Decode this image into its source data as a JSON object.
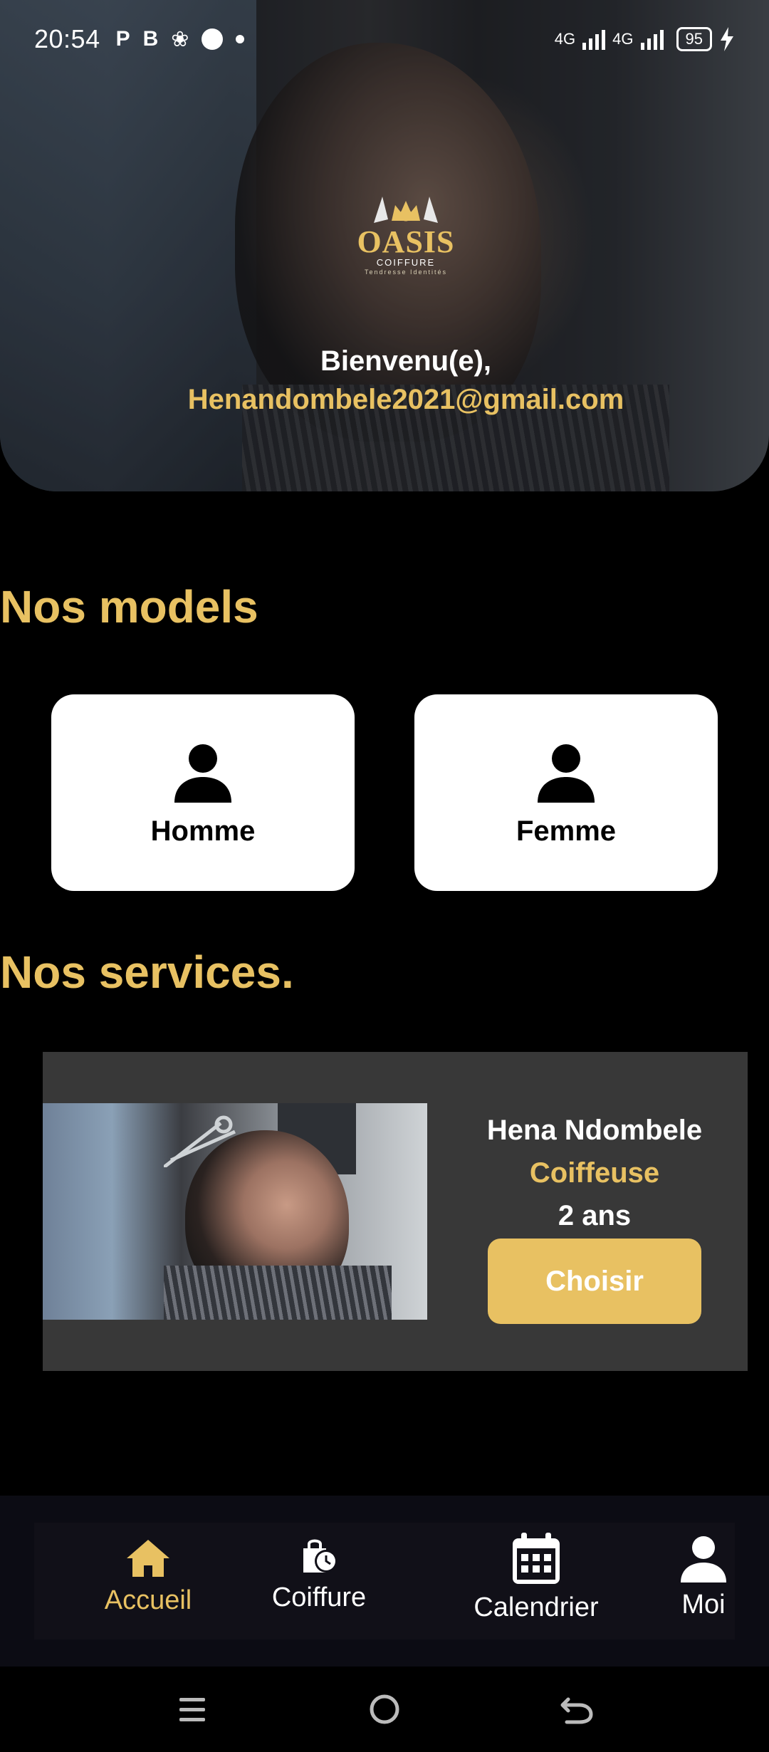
{
  "status_bar": {
    "time": "20:54",
    "left_icons": [
      "P",
      "B"
    ],
    "network_1": "4G",
    "network_2": "4G",
    "battery": "95"
  },
  "hero": {
    "logo": {
      "word": "OASIS",
      "sub": "COIFFURE",
      "tag": "Tendresse Identités"
    },
    "welcome_label": "Bienvenu(e),",
    "email": "Henandombele2021@gmail.com"
  },
  "models": {
    "title": "Nos models",
    "items": [
      {
        "label": "Homme"
      },
      {
        "label": "Femme"
      }
    ]
  },
  "services": {
    "title": "Nos services.",
    "card": {
      "name": "Hena Ndombele",
      "role": "Coiffeuse",
      "years": "2 ans",
      "button": "Choisir"
    }
  },
  "bottom_nav": {
    "items": [
      {
        "label": "Accueil",
        "icon": "home-icon",
        "active": true
      },
      {
        "label": "Coiffure",
        "icon": "shopping-bag-clock-icon"
      },
      {
        "label": "Calendrier",
        "icon": "calendar-icon"
      },
      {
        "label": "Moi",
        "icon": "person-icon"
      }
    ]
  },
  "colors": {
    "accent": "#e8c162",
    "background": "#000000",
    "card": "#383838"
  }
}
